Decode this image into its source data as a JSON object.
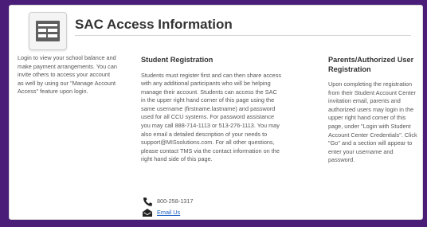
{
  "header": {
    "title": "SAC Access Information",
    "icon": "table-document-icon"
  },
  "left": {
    "text": "Login to view your school balance and make payment arrangements. You can invite others to access your account as well by using our \"Manage Account Access\" feature upon login."
  },
  "student": {
    "heading": "Student Registration",
    "text": "Students must register first and can then share access with any additional participants who will be helping manage their account. Students can access the SAC in the upper right hand corner of this page using the same username (firstname.lastname) and password used for all CCU systems. For password assistance you may call 888-714-1113 or 513-276-1113. You may also email a detailed description of your needs to support@MISsolutions.com. For all other questions, please contact TMS via the contact information on the right hand side of this page."
  },
  "parents": {
    "heading": "Parents/Authorized User Registration",
    "text": "Upon completing the registration from their Student Account Center invitation email, parents and authorized users may login in the upper right hand corner of this page, under \"Login with Student Account Center Credentials\". Click \"Go\" and a section will appear to enter your username and password."
  },
  "contact": {
    "phone": "800-258-1317",
    "email_label": "Email Us",
    "phone_icon": "phone-icon",
    "email_icon": "envelope-icon"
  },
  "colors": {
    "background": "#4a1e78",
    "link": "#1a5fc4"
  }
}
